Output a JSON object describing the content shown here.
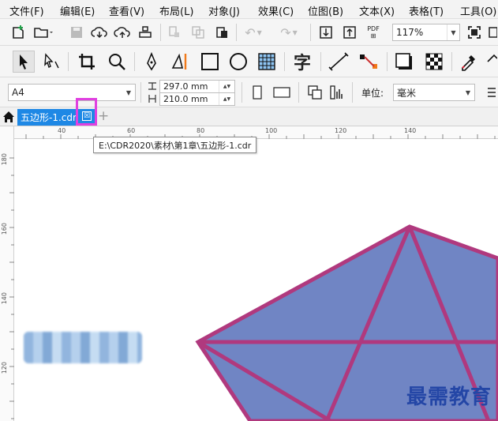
{
  "menu": [
    "文件(F)",
    "编辑(E)",
    "查看(V)",
    "布局(L)",
    "对象(J)",
    "效果(C)",
    "位图(B)",
    "文本(X)",
    "表格(T)",
    "工具(O)"
  ],
  "toolbar": {
    "zoom": "117%",
    "pdf_label": "PDF"
  },
  "property_bar": {
    "page_size": "A4",
    "width": "297.0 mm",
    "height": "210.0 mm",
    "unit_label": "单位:",
    "unit_value": "毫米"
  },
  "tab": {
    "title": "五边形-1.cdr",
    "close_symbol": "☒",
    "add_symbol": "+"
  },
  "tooltip": "E:\\CDR2020\\素材\\第1章\\五边形-1.cdr",
  "ruler": {
    "h_labels": [
      "40",
      "60",
      "80",
      "100",
      "120",
      "140"
    ],
    "v_labels": [
      "180",
      "160",
      "140",
      "120"
    ]
  },
  "colors": {
    "pentagon_fill": "#7085c4",
    "pentagon_stroke": "#b0397e",
    "tab_active": "#1e88e5",
    "highlight": "#e040e0"
  },
  "watermark": "最需教育"
}
